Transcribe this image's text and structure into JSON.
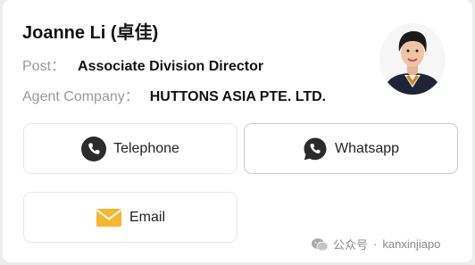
{
  "agent": {
    "name": "Joanne Li (卓佳)",
    "post_label": "Post：",
    "post_value": "Associate Division Director",
    "company_label": "Agent Company：",
    "company_value": "HUTTONS ASIA PTE. LTD."
  },
  "actions": {
    "telephone_label": "Telephone",
    "whatsapp_label": "Whatsapp",
    "email_label": "Email"
  },
  "icons": {
    "telephone": "phone-icon",
    "whatsapp": "whatsapp-icon",
    "email": "envelope-icon",
    "watermark": "wechat-icon"
  },
  "colors": {
    "email_icon": "#f5b82e",
    "icon_dark": "#2b2b2b",
    "label_gray": "#9a9a9a"
  },
  "watermark": {
    "channel": "公众号",
    "separator": "·",
    "account": "kanxinjiapo"
  }
}
